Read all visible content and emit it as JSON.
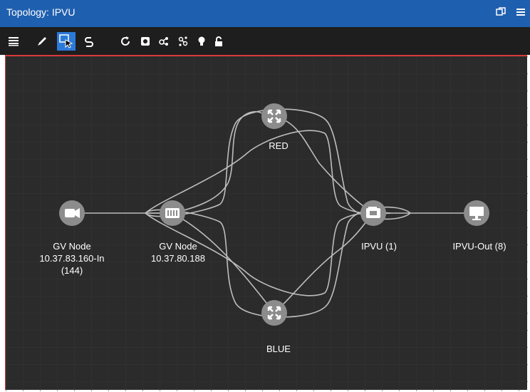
{
  "window": {
    "title": "Topology: IPVU",
    "controls": [
      {
        "name": "restore-window-icon"
      },
      {
        "name": "menu-icon"
      }
    ]
  },
  "toolbar": {
    "tools": [
      {
        "name": "list-icon",
        "selected": false
      },
      {
        "name": "pencil-icon",
        "selected": false
      },
      {
        "name": "select-pointer-icon",
        "selected": true
      },
      {
        "name": "link-icon",
        "selected": false
      },
      {
        "name": "refresh-icon",
        "selected": false
      },
      {
        "name": "layout-icon",
        "selected": false
      },
      {
        "name": "share-icon",
        "selected": false
      },
      {
        "name": "network-icon",
        "selected": false
      },
      {
        "name": "lightbulb-icon",
        "selected": false
      },
      {
        "name": "unlock-icon",
        "selected": false
      }
    ]
  },
  "nodes": {
    "red": {
      "label": "RED",
      "icon": "switch-arrows-icon"
    },
    "blue": {
      "label": "BLUE",
      "icon": "switch-arrows-icon"
    },
    "gv_in": {
      "label_line1": "GV Node",
      "label_line2": "10.37.83.160-In",
      "label_line3": "(144)",
      "icon": "camera-icon"
    },
    "gv_mid": {
      "label_line1": "GV Node",
      "label_line2": "10.37.80.188",
      "icon": "router-rack-icon"
    },
    "ipvu": {
      "label": "IPVU (1)",
      "icon": "film-reel-icon"
    },
    "ipvu_out": {
      "label": "IPVU-Out (8)",
      "icon": "monitor-icon"
    }
  },
  "colors": {
    "titlebar": "#1f5faf",
    "toolbar": "#1e1e1e",
    "canvas": "#2b2b2b",
    "node": "#8c8c8c",
    "link": "#bdbdbd",
    "selection": "#2b7ad9",
    "border": "#d83a3a"
  }
}
